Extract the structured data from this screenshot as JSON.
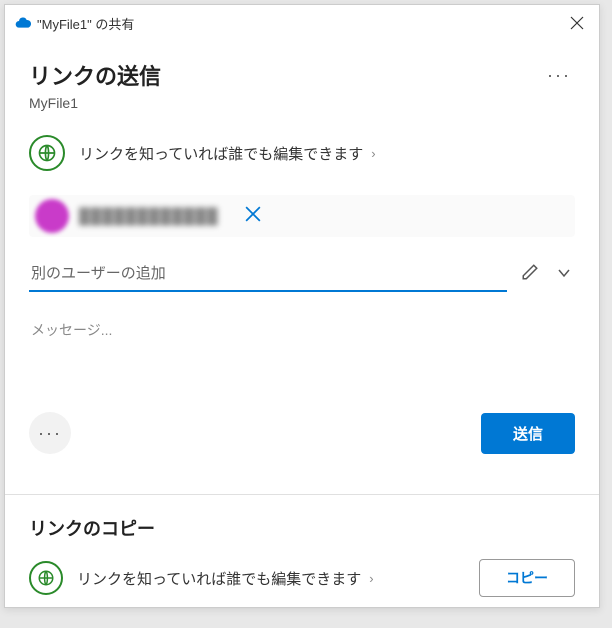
{
  "titlebar": {
    "title": "\"MyFile1\" の共有"
  },
  "header": {
    "title": "リンクの送信",
    "file_name": "MyFile1"
  },
  "permission": {
    "text": "リンクを知っていれば誰でも編集できます"
  },
  "recipient": {
    "name": "████████████"
  },
  "inputs": {
    "user_placeholder": "別のユーザーの追加",
    "message_placeholder": "メッセージ..."
  },
  "buttons": {
    "send": "送信",
    "copy": "コピー"
  },
  "copy_section": {
    "title": "リンクのコピー",
    "permission_text": "リンクを知っていれば誰でも編集できます"
  }
}
